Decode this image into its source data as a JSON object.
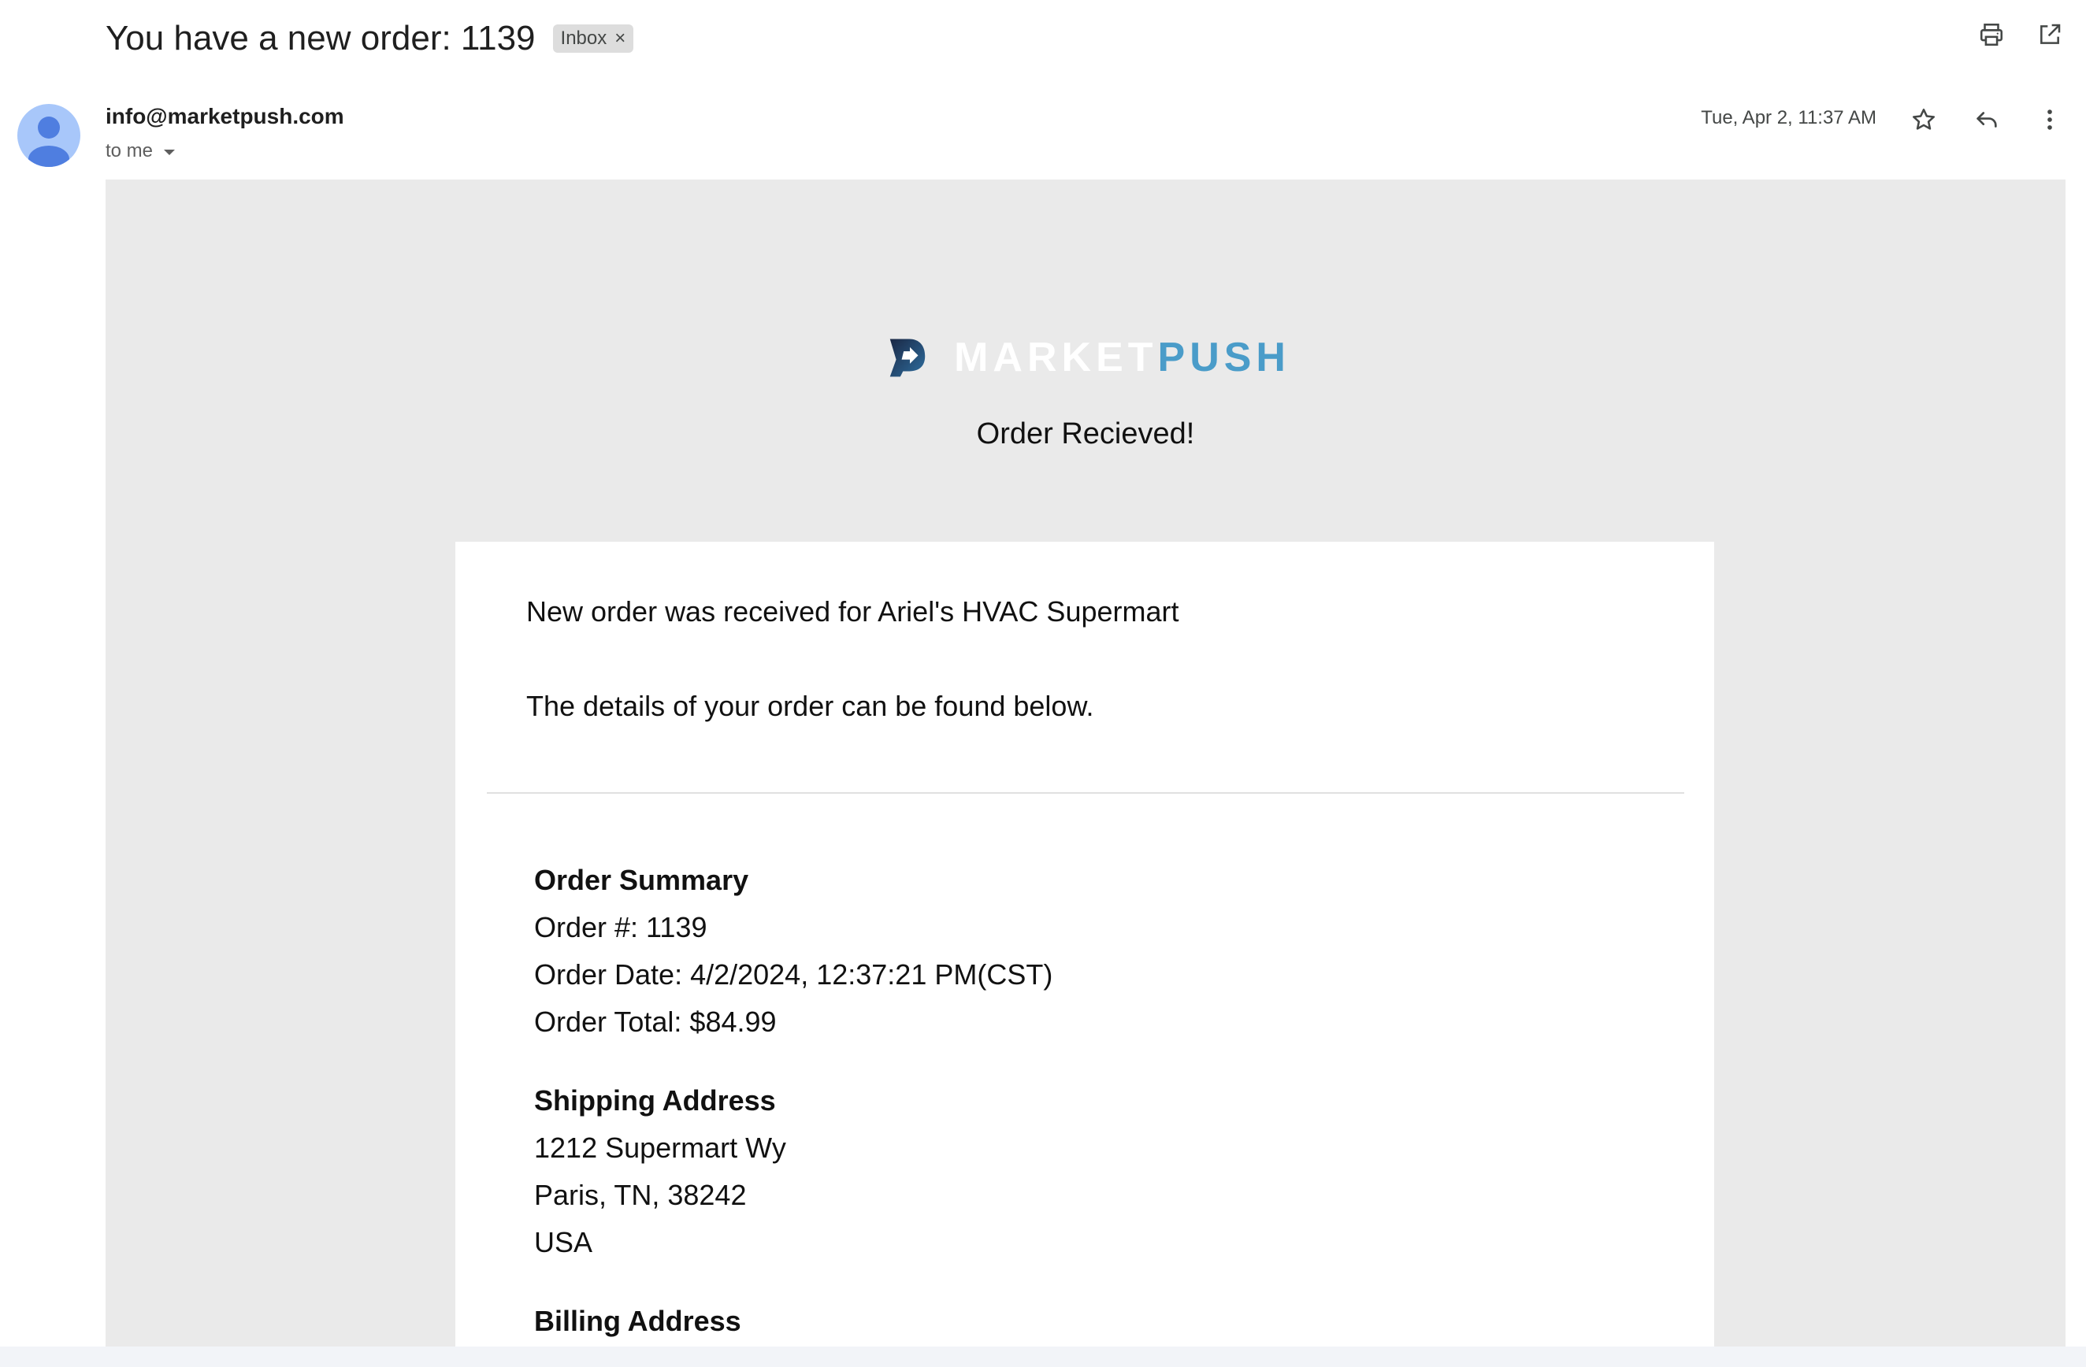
{
  "email": {
    "subject": "You have a new order: 1139",
    "label": "Inbox",
    "sender": "info@marketpush.com",
    "recipient": "to me",
    "date": "Tue, Apr 2, 11:37 AM"
  },
  "icons": {
    "print": "print-icon",
    "open_new_window": "open-in-new-icon",
    "star": "star-icon",
    "reply": "reply-icon",
    "more": "more-vert-icon",
    "avatar": "person-icon"
  },
  "brand": {
    "word_part1": "MARKET",
    "word_part2": "PUSH",
    "colors": {
      "logo_dark": "#1a2744",
      "logo_light": "#2f6fa0",
      "accent": "#4a9cc9"
    }
  },
  "body": {
    "headline": "Order Recieved!",
    "intro": "New order was received for Ariel's HVAC Supermart",
    "details_note": "The details of your order can be found below.",
    "order_summary": {
      "heading": "Order Summary",
      "order_number": "Order #: 1139",
      "order_date": "Order Date: 4/2/2024, 12:37:21 PM(CST)",
      "order_total": "Order Total: $84.99"
    },
    "shipping": {
      "heading": "Shipping Address",
      "line1": "1212 Supermart Wy",
      "line2": "Paris, TN, 38242",
      "line3": "USA"
    },
    "billing": {
      "heading": "Billing Address"
    }
  }
}
